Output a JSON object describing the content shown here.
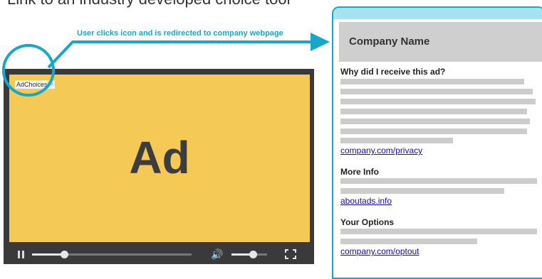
{
  "caption": "Link to an industry developed choice tool",
  "arrow_label": "User clicks icon and is redirected to company webpage",
  "player": {
    "ad_text": "Ad",
    "adchoices_label": "AdChoices",
    "progress_fraction": 0.2,
    "volume_fraction": 0.6,
    "colors": {
      "ad_background": "#f4c955",
      "player_background": "#3a3a3a"
    },
    "icons": [
      "pause-icon",
      "volume-icon",
      "fullscreen-icon",
      "adchoices-triangle-icon"
    ]
  },
  "company_page": {
    "name": "Company Name",
    "sections": [
      {
        "title": "Why did I receive this ad?",
        "link": "company.com/privacy"
      },
      {
        "title": "More Info",
        "link": "aboutads.info"
      },
      {
        "title": "Your Options",
        "link": "company.com/optout"
      }
    ],
    "colors": {
      "accent": "#16a8c6",
      "header_bar": "#a6e3ee",
      "header": "#cfcfcf",
      "link": "#1a0dab"
    }
  }
}
